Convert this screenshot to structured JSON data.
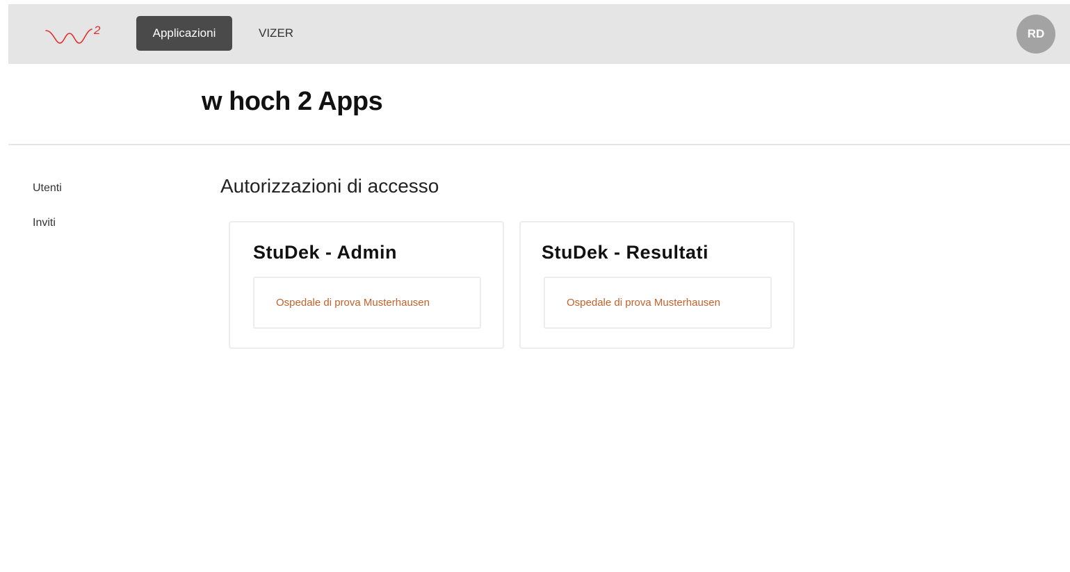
{
  "header": {
    "logo": {
      "text": "w",
      "sup": "2",
      "color": "#e0302c"
    },
    "nav": {
      "active_label": "Applicazioni",
      "link_label": "VIZER"
    },
    "avatar_initials": "RD"
  },
  "page_title": "w hoch 2 Apps",
  "sidebar": {
    "items": [
      {
        "label": "Utenti"
      },
      {
        "label": "Inviti"
      }
    ]
  },
  "main": {
    "section_title": "Autorizzazioni di accesso",
    "cards": [
      {
        "title": "StuDek - Admin",
        "org": "Ospedale di prova Musterhausen"
      },
      {
        "title": "StuDek - Resultati",
        "org": "Ospedale di prova Musterhausen"
      }
    ]
  },
  "colors": {
    "topbar_bg": "#e5e5e5",
    "active_nav_bg": "#4a4a4a",
    "avatar_bg": "#a3a3a3",
    "org_link": "#c0622b"
  }
}
